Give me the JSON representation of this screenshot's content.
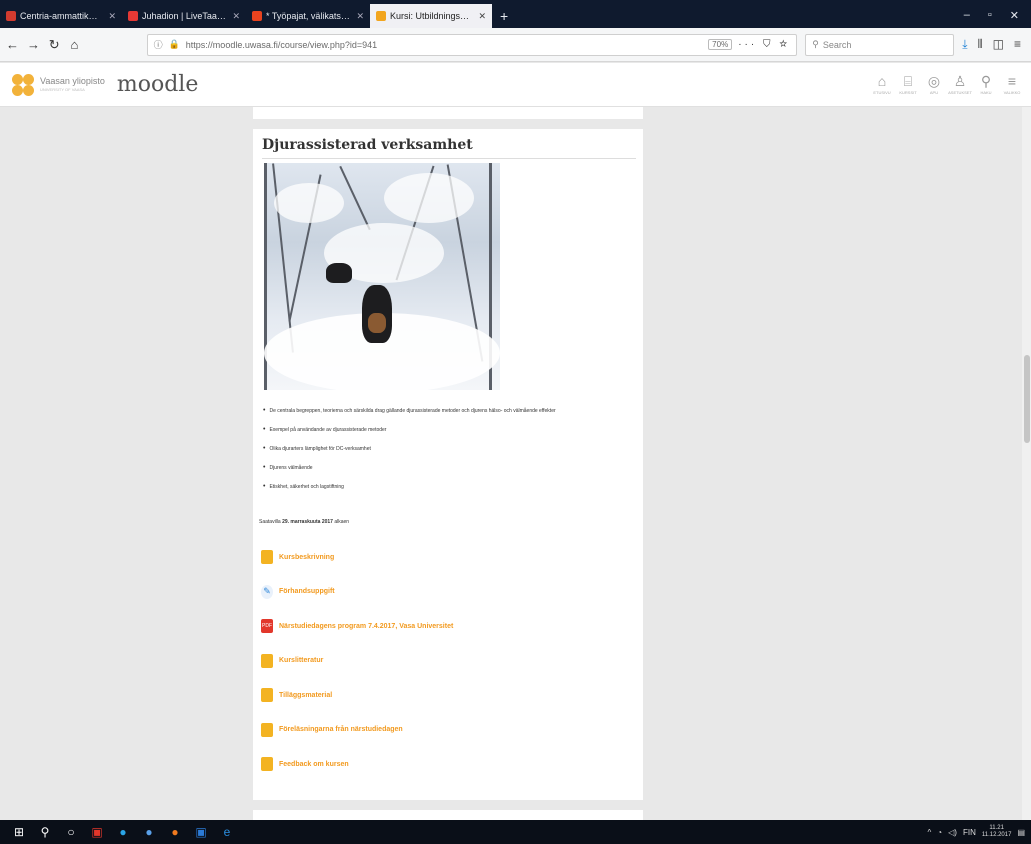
{
  "browser": {
    "tabs": [
      {
        "label": "Centria-ammattikorkeakoulu",
        "color": "#d23b2f",
        "active": false
      },
      {
        "label": "Juhadion | LiveTaajuus.fi",
        "color": "#e53935",
        "active": false
      },
      {
        "label": "* Työpajat, välikatselmukset j...",
        "color": "#e8431f",
        "active": false
      },
      {
        "label": "Kursi: Utbildningsmodul inom",
        "color": "#f2a51e",
        "active": true
      }
    ],
    "url": "https://moodle.uwasa.fi/course/view.php?id=941",
    "zoom": "70%",
    "search_placeholder": "Search"
  },
  "header": {
    "university": "Vaasan yliopisto",
    "university_sub": "UNIVERSITY OF VAASA",
    "brand": "moodle",
    "nav": [
      {
        "label": "ETUSIVU",
        "icon": "⌂"
      },
      {
        "label": "KURSSIT",
        "icon": "⌸"
      },
      {
        "label": "APU",
        "icon": "◎"
      },
      {
        "label": "ASETUKSET",
        "icon": "♙"
      },
      {
        "label": "HAKU",
        "icon": "⚲"
      },
      {
        "label": "VALIKKO",
        "icon": "≡"
      }
    ]
  },
  "section": {
    "title": "Djurassisterad verksamhet",
    "bullets": [
      "De centrala begreppen, teorierna och särskilda drag gällande djurassisterade metoder och djurens hälso- och välmående effekter",
      "Exempel på användande av djurassisterade metoder",
      "Olika djurarters lämplighet för DC-verksamhet",
      "Djurens välmående",
      "Etiskhet, säkerhet och lagstiftning"
    ],
    "updated_prefix": "Saatavilla",
    "updated_date": "29. marraskuuta 2017",
    "updated_suffix": "alkaen",
    "activities": [
      {
        "label": "Kursbeskrivning",
        "type": "folder"
      },
      {
        "label": "Förhandsuppgift",
        "type": "assign"
      },
      {
        "label": "Närstudiedagens program 7.4.2017, Vasa Universitet",
        "type": "pdf"
      },
      {
        "label": "Kurslitteratur",
        "type": "folder"
      },
      {
        "label": "Tilläggsmaterial",
        "type": "folder"
      },
      {
        "label": "Föreläsningarna från närstudiedagen",
        "type": "folder"
      },
      {
        "label": "Feedback om kursen",
        "type": "folder"
      }
    ]
  },
  "taskbar": {
    "lang": "FIN",
    "time": "11.21",
    "date": "11.12.2017"
  }
}
